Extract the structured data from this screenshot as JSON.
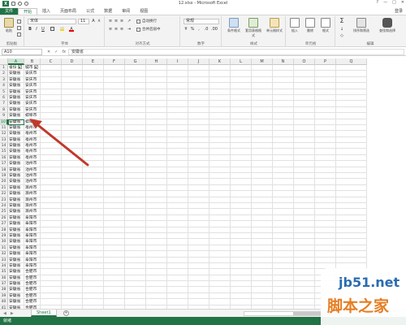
{
  "window": {
    "title": "12.xlsx - Microsoft Excel",
    "controls": [
      "?",
      "—",
      "□",
      "✕"
    ]
  },
  "tabs": [
    "文件",
    "开始",
    "插入",
    "页面布局",
    "公式",
    "数据",
    "审阅",
    "视图"
  ],
  "active_tab": 1,
  "login": "登录",
  "ribbon": {
    "clipboard": {
      "paste": "粘贴",
      "label": "剪贴板"
    },
    "font": {
      "name": "宋体",
      "size": "11",
      "label": "字体"
    },
    "alignment": {
      "wrap": "自动换行",
      "merge": "合并后居中",
      "label": "对齐方式"
    },
    "number": {
      "format": "常规",
      "label": "数字"
    },
    "styles": {
      "conditional": "条件格式",
      "table": "套用表格格式",
      "cell": "单元格样式",
      "label": "样式"
    },
    "cells": {
      "insert": "插入",
      "delete": "删除",
      "format": "格式",
      "label": "单元格"
    },
    "editing": {
      "sort": "排序和筛选",
      "find": "查找和选择",
      "label": "编辑"
    }
  },
  "formula_bar": {
    "name_box": "A10",
    "formula": "安徽省",
    "fx": "fx"
  },
  "columns": [
    "A",
    "B",
    "C",
    "D",
    "E",
    "F",
    "G",
    "H",
    "I",
    "J",
    "K",
    "L",
    "M",
    "N",
    "O",
    "P",
    "Q"
  ],
  "selected_column": "A",
  "header_row": [
    "省份",
    "城市"
  ],
  "rows": [
    [
      "安徽省",
      "安庆市"
    ],
    [
      "安徽省",
      "安庆市"
    ],
    [
      "安徽省",
      "安庆市"
    ],
    [
      "安徽省",
      "安庆市"
    ],
    [
      "安徽省",
      "安庆市"
    ],
    [
      "安徽省",
      "安庆市"
    ],
    [
      "安徽省",
      "安庆市"
    ],
    [
      "安徽省",
      "蚌埠市"
    ],
    [
      "安徽省",
      "蚌埠市"
    ],
    [
      "安徽省",
      "亳州市"
    ],
    [
      "安徽省",
      "亳州市"
    ],
    [
      "安徽省",
      "亳州市"
    ],
    [
      "安徽省",
      "亳州市"
    ],
    [
      "安徽省",
      "亳州市"
    ],
    [
      "安徽省",
      "亳州市"
    ],
    [
      "安徽省",
      "池州市"
    ],
    [
      "安徽省",
      "池州市"
    ],
    [
      "安徽省",
      "池州市"
    ],
    [
      "安徽省",
      "池州市"
    ],
    [
      "安徽省",
      "滁州市"
    ],
    [
      "安徽省",
      "滁州市"
    ],
    [
      "安徽省",
      "滁州市"
    ],
    [
      "安徽省",
      "滁州市"
    ],
    [
      "安徽省",
      "滁州市"
    ],
    [
      "安徽省",
      "阜阳市"
    ],
    [
      "安徽省",
      "阜阳市"
    ],
    [
      "安徽省",
      "阜阳市"
    ],
    [
      "安徽省",
      "阜阳市"
    ],
    [
      "安徽省",
      "阜阳市"
    ],
    [
      "安徽省",
      "阜阳市"
    ],
    [
      "安徽省",
      "阜阳市"
    ],
    [
      "安徽省",
      "阜阳市"
    ],
    [
      "安徽省",
      "阜阳市"
    ],
    [
      "安徽省",
      "合肥市"
    ],
    [
      "安徽省",
      "合肥市"
    ],
    [
      "安徽省",
      "合肥市"
    ],
    [
      "安徽省",
      "合肥市"
    ],
    [
      "安徽省",
      "合肥市"
    ],
    [
      "安徽省",
      "合肥市"
    ],
    [
      "安徽省",
      "合肥市"
    ],
    [
      "安徽省",
      "合肥市"
    ]
  ],
  "active_row": 10,
  "sheet": {
    "name": "Sheet1",
    "add": "+"
  },
  "status": "就绪",
  "watermark": {
    "site": "jb51.net",
    "name": "脚本之家"
  },
  "colors": {
    "accent": "#217346",
    "arrow": "#c0392b"
  }
}
